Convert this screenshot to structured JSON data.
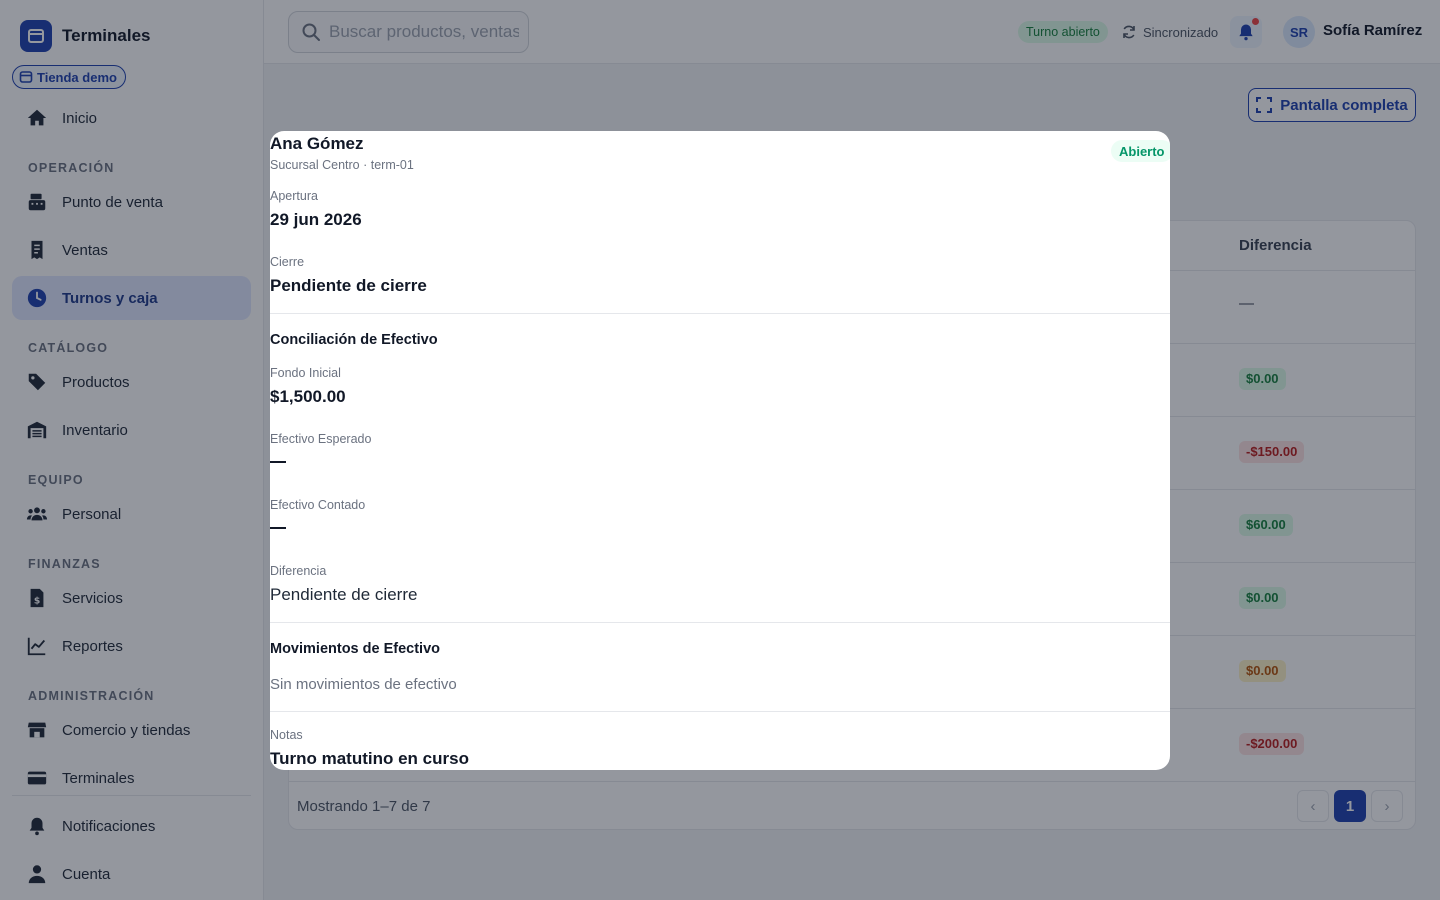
{
  "sidebar": {
    "brand": "Terminales",
    "store_chip": "Tienda demo",
    "items": [
      {
        "label": "Inicio",
        "icon": "home-icon"
      },
      {
        "label": "Punto de venta",
        "icon": "cash-register-icon"
      },
      {
        "label": "Ventas",
        "icon": "receipt-icon"
      },
      {
        "label": "Turnos y caja",
        "icon": "clock-icon"
      },
      {
        "label": "Productos",
        "icon": "tag-icon"
      },
      {
        "label": "Inventario",
        "icon": "warehouse-icon"
      },
      {
        "label": "Personal",
        "icon": "users-icon"
      },
      {
        "label": "Servicios",
        "icon": "invoice-dollar-icon"
      },
      {
        "label": "Reportes",
        "icon": "chart-line-icon"
      },
      {
        "label": "Comercio y tiendas",
        "icon": "store-icon"
      },
      {
        "label": "Terminales",
        "icon": "credit-card-icon"
      },
      {
        "label": "Notificaciones",
        "icon": "bell-icon"
      },
      {
        "label": "Cuenta",
        "icon": "user-icon"
      }
    ],
    "sections": {
      "operacion": "OPERACIÓN",
      "catalogo": "CATÁLOGO",
      "equipo": "EQUIPO",
      "finanzas": "FINANZAS",
      "administracion": "ADMINISTRACIÓN"
    },
    "active_item": "Turnos y caja"
  },
  "header": {
    "search_placeholder": "Buscar productos, ventas...",
    "shift_status": "Turno abierto",
    "sync_status": "Sincronizado",
    "user_initials": "SR",
    "user_name": "Sofía Ramírez"
  },
  "main": {
    "fullscreen_label": "Pantalla completa",
    "table": {
      "visible_header": "Diferencia",
      "diff_values": [
        "—",
        "$0.00",
        "-$150.00",
        "$60.00",
        "$0.00",
        "$0.00",
        "-$200.00"
      ],
      "diff_tones": [
        "none",
        "green",
        "red",
        "green",
        "green",
        "amber",
        "red"
      ]
    },
    "pagination": {
      "showing": "Mostrando 1–7 de 7",
      "current_page": "1",
      "prev": "‹",
      "next": "›"
    }
  },
  "modal": {
    "title": "Ana Gómez",
    "subtitle": "Sucursal Centro · term-01",
    "status_badge": "Abierto",
    "apertura_label": "Apertura",
    "apertura_value": "29 jun 2026",
    "cierre_label": "Cierre",
    "cierre_value": "Pendiente de cierre",
    "conciliacion_title": "Conciliación de Efectivo",
    "fondo_label": "Fondo Inicial",
    "fondo_value": "$1,500.00",
    "esperado_label": "Efectivo Esperado",
    "contado_label": "Efectivo Contado",
    "diferencia_label": "Diferencia",
    "diferencia_value": "Pendiente de cierre",
    "movimientos_title": "Movimientos de Efectivo",
    "movimientos_empty": "Sin movimientos de efectivo",
    "notas_label": "Notas",
    "notas_value": "Turno matutino en curso"
  },
  "colors": {
    "accent": "#1e40af",
    "success": "#15803d",
    "danger": "#b91c1c",
    "warning": "#b45309"
  }
}
